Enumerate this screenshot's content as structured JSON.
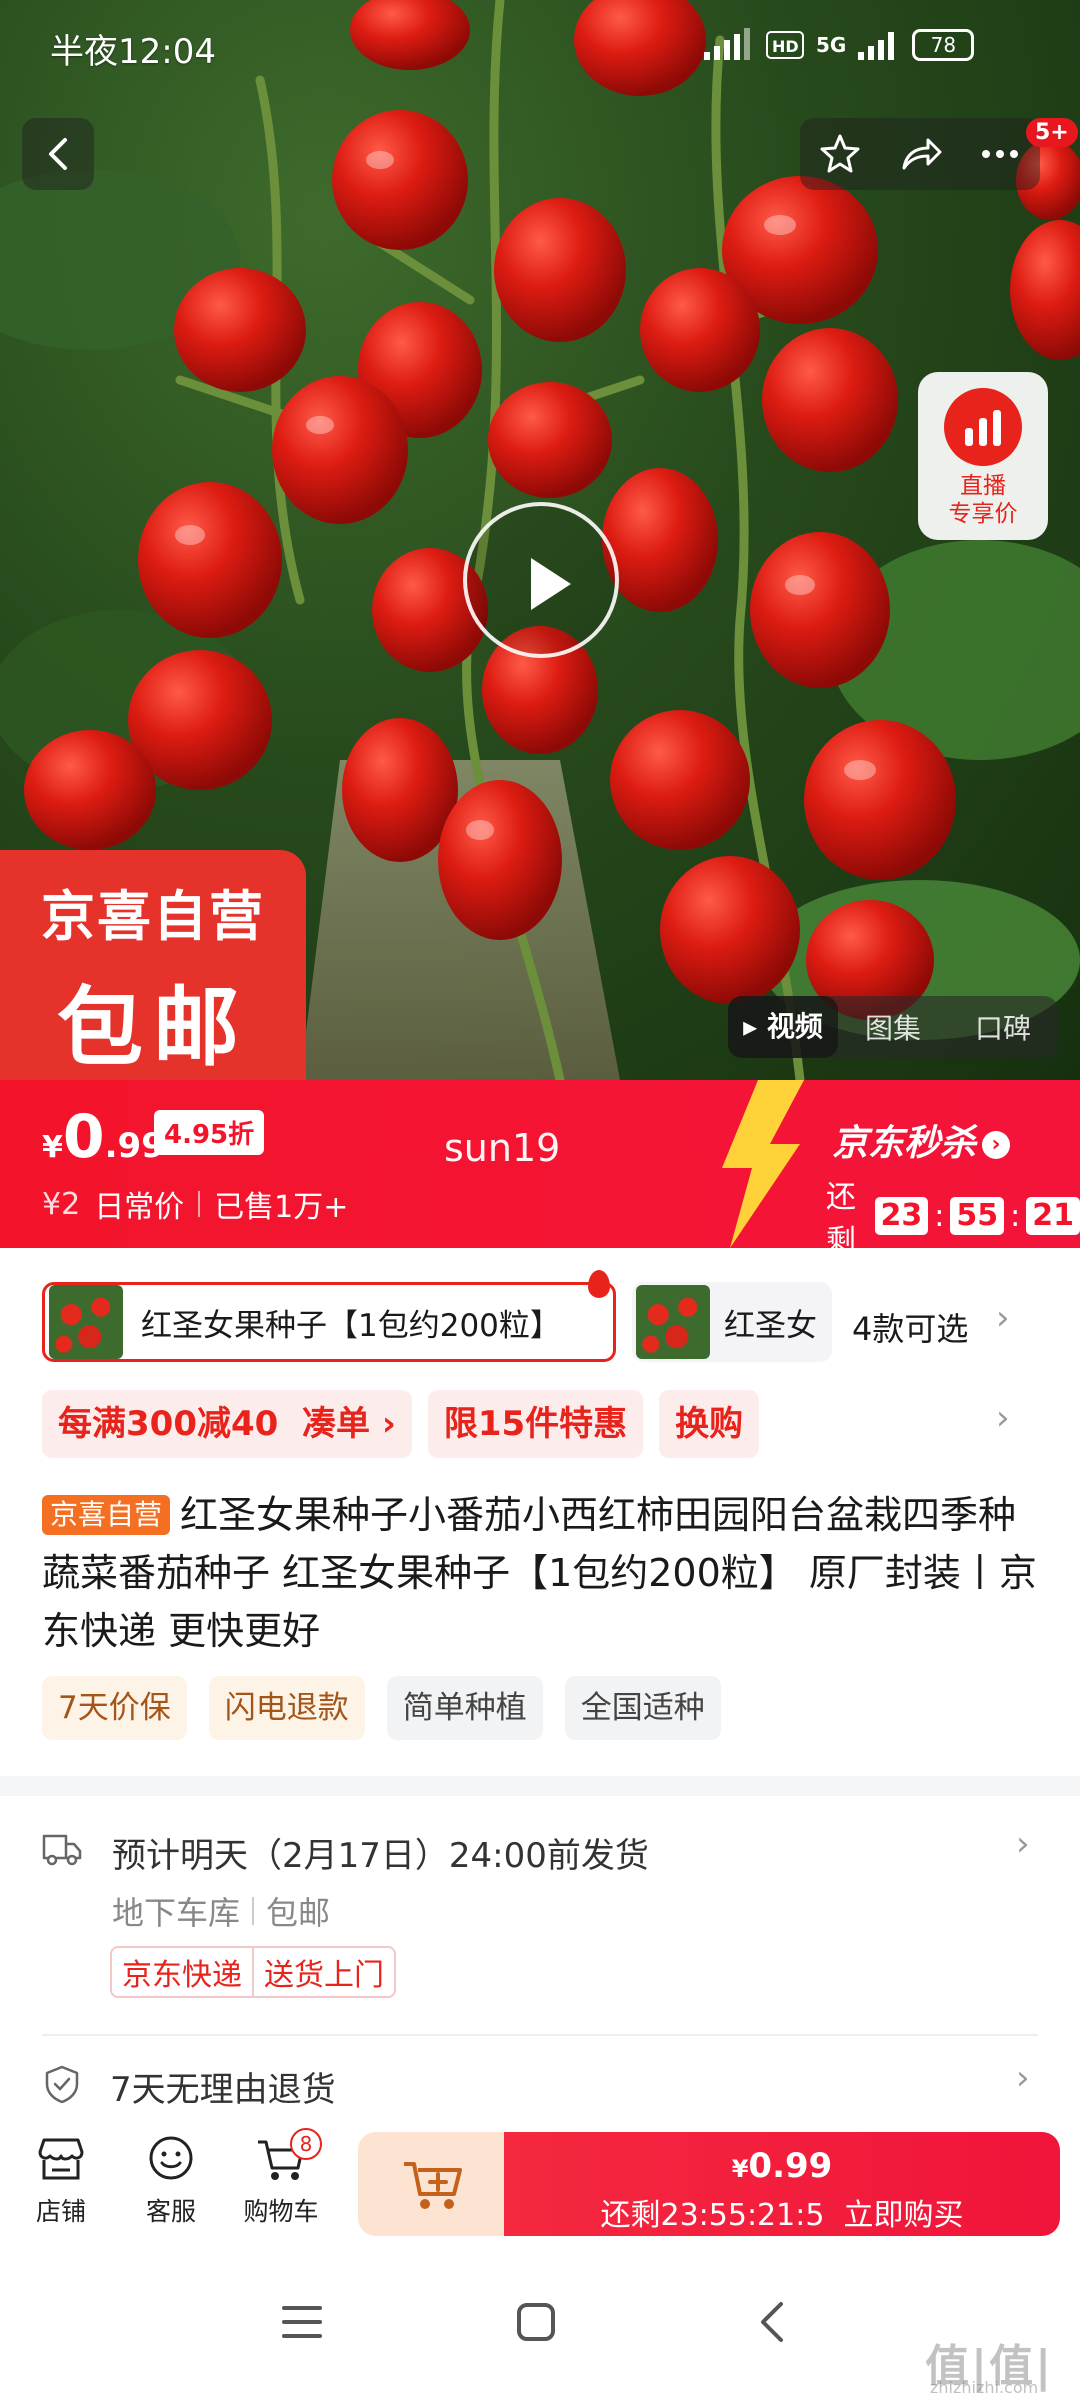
{
  "status_bar": {
    "time": "半夜12:04",
    "network": "5G",
    "battery": "78"
  },
  "top_actions": {
    "notification_badge": "5+"
  },
  "live": {
    "label_line1": "直播",
    "label_line2": "专享价"
  },
  "promo_sticker": {
    "line1": "京喜自营",
    "line2": "包邮"
  },
  "media_tabs": [
    "视频",
    "图集",
    "口碑"
  ],
  "price": {
    "currency": "¥",
    "integer": "0",
    "decimal": ".99",
    "discount": "4.95折",
    "original": "¥2",
    "original_label": "日常价",
    "sold": "已售1万+",
    "watermark_user": "sun19"
  },
  "seckill": {
    "title": "京东秒杀",
    "remaining_label": "还剩",
    "hours": "23",
    "minutes": "55",
    "seconds": "21"
  },
  "variants": {
    "selected": "红圣女果种子【1包约200粒】",
    "other": "红圣女",
    "count": "4款可选"
  },
  "promotions": {
    "discount_prefix": "每满300减40",
    "discount_action": "凑单",
    "limit": "限15件特惠",
    "swap": "换购"
  },
  "product": {
    "self_tag": "京喜自营",
    "title": "红圣女果种子小番茄小西红柿田园阳台盆栽四季种蔬菜番茄种子 红圣女果种子【1包约200粒】 原厂封装丨京东快递 更快更好",
    "features": [
      "7天价保",
      "闪电退款",
      "简单种植",
      "全国适种"
    ]
  },
  "shipping": {
    "eta": "预计明天（2月17日）24:00前发货",
    "location": "地下车库",
    "fee": "包邮",
    "tag1": "京东快递",
    "tag2": "送货上门"
  },
  "returns": {
    "text": "7天无理由退货"
  },
  "bottom_bar": {
    "store": "店铺",
    "service": "客服",
    "cart": "购物车",
    "cart_count": "8",
    "buy_price_currency": "¥",
    "buy_price": "0.99",
    "buy_countdown": "还剩23:55:21:5",
    "buy_label": "立即购买"
  },
  "watermark": {
    "brand": "值|值|值",
    "site": "zhizhizhi.com"
  },
  "colors": {
    "primary_red": "#f3142b",
    "self_orange": "#f46f21",
    "feature_brown": "#a4561a"
  }
}
